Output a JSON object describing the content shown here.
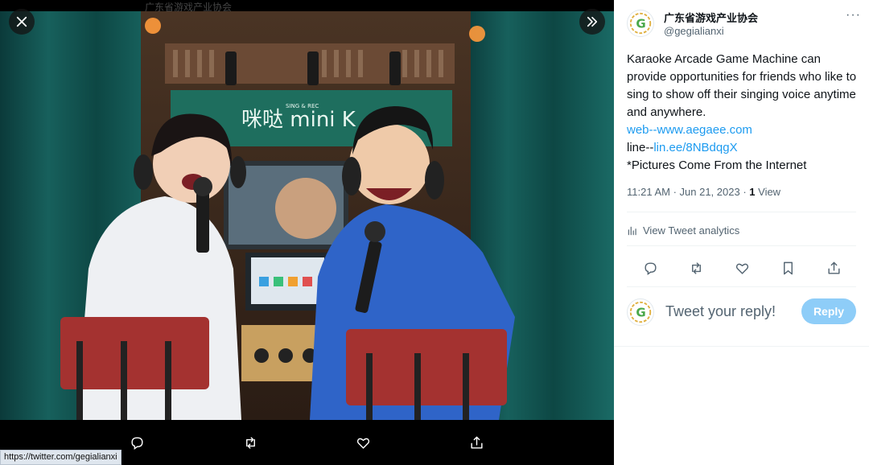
{
  "viewer": {
    "top_ghost_text": "广东省游戏产业协会",
    "status_url": "https://twitter.com/gegialianxi",
    "photo_sign_text": "咪哒 mini K",
    "photo_sign_small": "SING & REC"
  },
  "tweet": {
    "author_name": "广东省游戏产业协会",
    "author_handle": "@gegialianxi",
    "more_label": "···",
    "text_line1": "Karaoke Arcade Game Machine can provide opportunities for friends who like to sing to show off their singing voice anytime and anywhere.",
    "web_prefix": "web--",
    "web_link": "www.aegaee.com",
    "line_prefix": "line--",
    "line_link": "lin.ee/8NBdqgX",
    "text_last": "*Pictures Come From the Internet",
    "timestamp": "11:21 AM · Jun 21, 2023",
    "view_count": "1",
    "view_label": " View",
    "analytics_label": "View Tweet analytics",
    "reply_placeholder": "Tweet your reply!",
    "reply_button": "Reply"
  },
  "colors": {
    "accent": "#1d9bf0",
    "reply_button_disabled": "#8ecdf8",
    "text_primary": "#0f1419",
    "text_secondary": "#536471"
  },
  "icons": [
    "close-icon",
    "expand-icon",
    "reply-icon",
    "retweet-icon",
    "like-icon",
    "share-icon",
    "bookmark-icon",
    "analytics-icon",
    "more-icon"
  ]
}
